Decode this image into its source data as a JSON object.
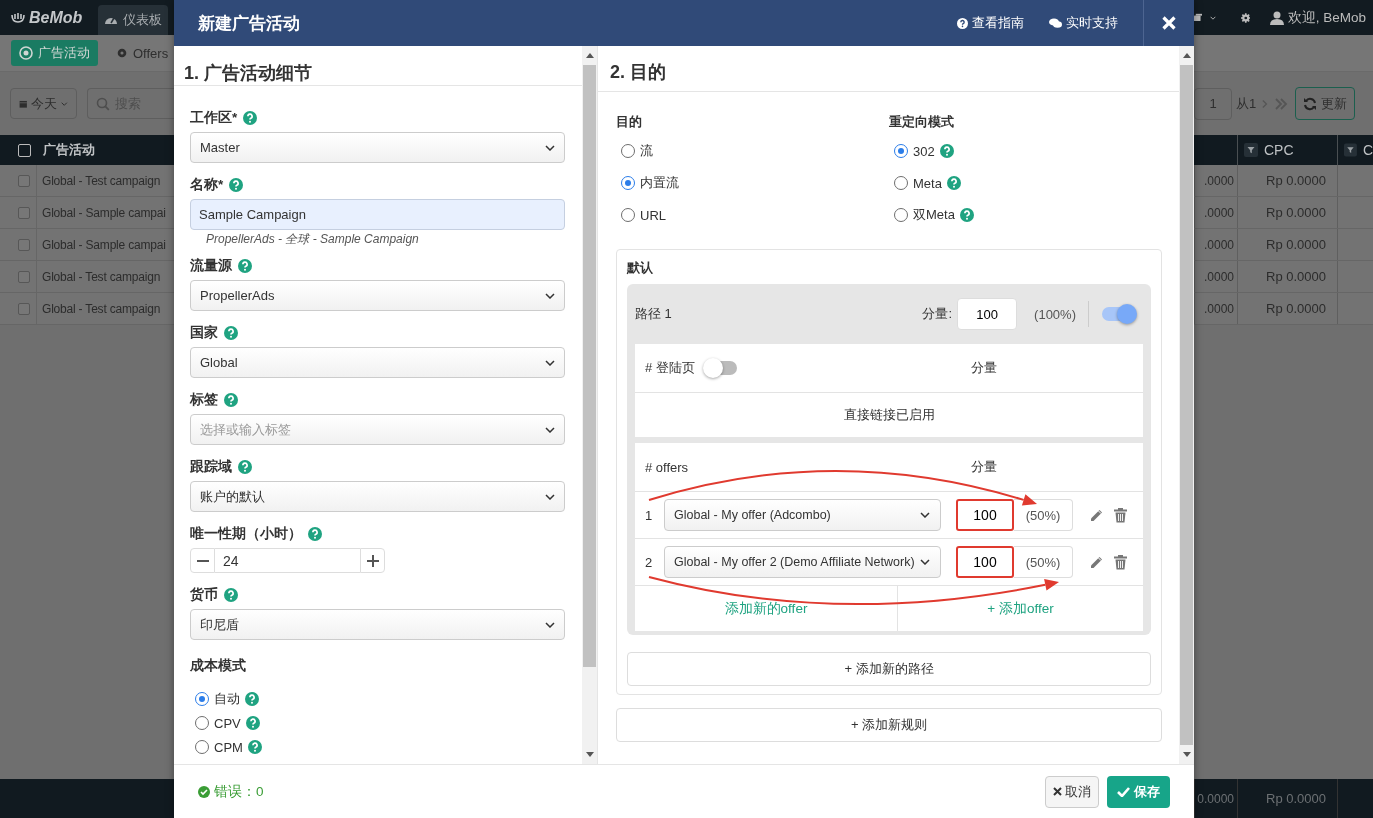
{
  "app": {
    "logo": "BeMob",
    "nav_tab": "仪表板",
    "user": "欢迎, BeMob",
    "subnav": [
      {
        "label": "广告活动",
        "selected": true
      },
      {
        "label": "Offers",
        "selected": false
      }
    ],
    "date_filter": "今天",
    "search": {
      "placeholder": "搜索"
    },
    "page_input": "1",
    "page_total": "从1",
    "refresh": "更新",
    "table": {
      "left_column": "广告活动",
      "header_checked": false,
      "right_columns": [
        "CPC",
        "C"
      ],
      "rows": [
        {
          "name": "Global - Test campaign",
          "checked": false,
          "column_2": ".0000",
          "cpc": "Rp 0.0000"
        },
        {
          "name": "Global - Sample campai",
          "checked": false,
          "column_2": ".0000",
          "cpc": "Rp 0.0000"
        },
        {
          "name": "Global - Sample campai",
          "checked": false,
          "column_2": ".0000",
          "cpc": "Rp 0.0000"
        },
        {
          "name": "Global - Test campaign",
          "checked": false,
          "column_2": ".0000",
          "cpc": "Rp 0.0000"
        },
        {
          "name": "Global - Test campaign",
          "checked": false,
          "column_2": ".0000",
          "cpc": "Rp 0.0000"
        }
      ],
      "footer": [
        "0.0000",
        "Rp 0.0000"
      ]
    }
  },
  "modal": {
    "title": "新建广告活动",
    "header_links": [
      "查看指南",
      "实时支持"
    ],
    "details": {
      "heading": "1. 广告活动细节",
      "fields": [
        {
          "kind": "select",
          "label": "工作区*",
          "help": true,
          "value": "Master"
        },
        {
          "kind": "text",
          "label": "名称*",
          "help": true,
          "value": "Sample Campaign",
          "hint": "PropellerAds - 全球 - Sample Campaign"
        },
        {
          "kind": "select",
          "label": "流量源",
          "help": true,
          "value": "PropellerAds"
        },
        {
          "kind": "select",
          "label": "国家",
          "help": true,
          "value": "Global"
        },
        {
          "kind": "select",
          "label": "标签",
          "help": true,
          "placeholder": "选择或输入标签"
        },
        {
          "kind": "select",
          "label": "跟踪域",
          "help": true,
          "value": "账户的默认"
        },
        {
          "kind": "stepper",
          "label": "唯一性期（小时）",
          "help": true,
          "value": "24"
        },
        {
          "kind": "select",
          "label": "货币",
          "help": true,
          "value": "印尼盾"
        },
        {
          "kind": "radios",
          "label": "成本模式",
          "help": false,
          "options": [
            {
              "label": "自动",
              "help": true,
              "selected": true
            },
            {
              "label": "CPV",
              "help": true,
              "selected": false
            },
            {
              "label": "CPM",
              "help": true,
              "selected": false
            }
          ]
        }
      ]
    },
    "destination": {
      "heading": "2. 目的",
      "target": {
        "label": "目的",
        "options": [
          {
            "label": "流",
            "selected": false
          },
          {
            "label": "内置流",
            "selected": true
          },
          {
            "label": "URL",
            "selected": false
          }
        ]
      },
      "redirect": {
        "label": "重定向模式",
        "options": [
          {
            "label": "302",
            "help": true,
            "selected": true
          },
          {
            "label": "Meta",
            "help": true,
            "selected": false
          },
          {
            "label": "双Meta",
            "help": true,
            "selected": false
          }
        ]
      },
      "rule": {
        "title": "默认",
        "path": {
          "name": "路径 1",
          "weight_label": "分量:",
          "weight": "100",
          "share": "(100%)",
          "on": true,
          "landers": {
            "label": "# 登陆页",
            "on": false,
            "weight_header": "分量",
            "message": "直接链接已启用"
          },
          "offers": {
            "label": "# offers",
            "weight_header": "分量",
            "rows": [
              {
                "index": "1",
                "offer": "Global - My offer (Adcombo)",
                "weight": "100",
                "share": "(50%)",
                "highlighted": true
              },
              {
                "index": "2",
                "offer": "Global - My offer 2 (Demo Affiliate Network)",
                "weight": "100",
                "share": "(50%)",
                "highlighted": true
              }
            ],
            "actions": [
              "添加新的offer",
              "+ 添加offer"
            ]
          }
        },
        "add_path": "+ 添加新的路径"
      },
      "add_rule": "+ 添加新规则"
    },
    "footer": {
      "errors": "错误：0",
      "cancel": "取消",
      "save": "保存"
    },
    "annotations": [
      {
        "kind": "arrow"
      },
      {
        "kind": "arrow"
      }
    ]
  }
}
